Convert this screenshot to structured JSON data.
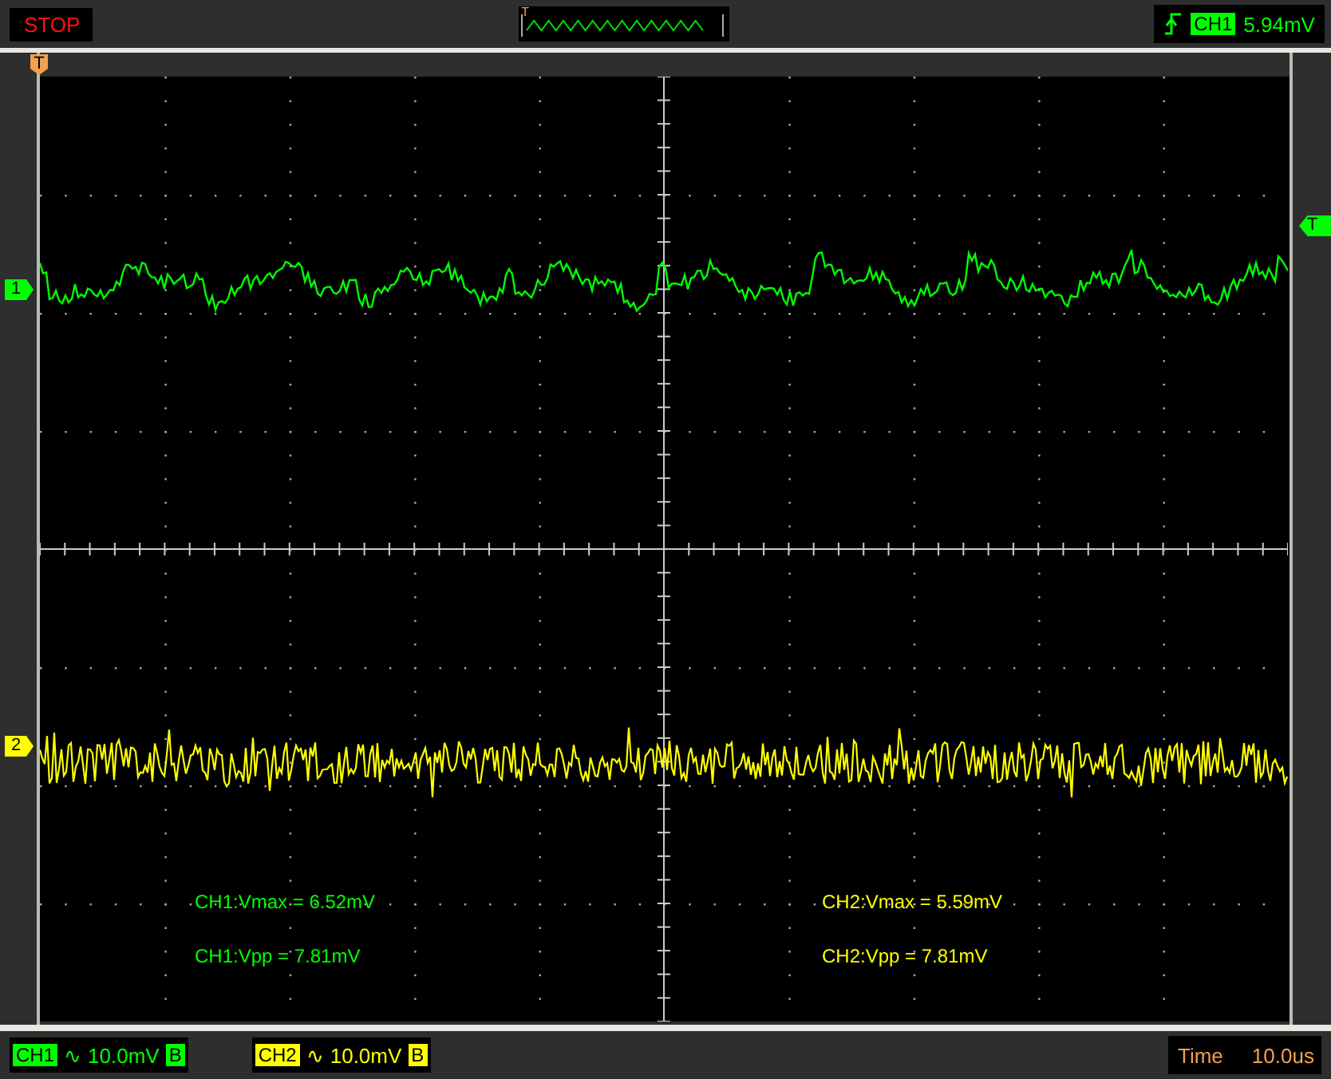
{
  "status": "STOP",
  "overview": {
    "marker": "T"
  },
  "trigger": {
    "channel": "CH1",
    "level": "5.94mV"
  },
  "markers": {
    "top": "T",
    "right": "T"
  },
  "channels": [
    {
      "marker": "1",
      "name": "CH1",
      "coupling": "∿",
      "scale": "10.0mV",
      "bandwidth": "B",
      "color": "#00ff00"
    },
    {
      "marker": "2",
      "name": "CH2",
      "coupling": "∿",
      "scale": "10.0mV",
      "bandwidth": "B",
      "color": "#ffff00"
    }
  ],
  "measurements": [
    {
      "text": "CH1:Vmax = 6.52mV",
      "color": "#00ff00"
    },
    {
      "text": "CH2:Vmax = 5.59mV",
      "color": "#ffff00"
    },
    {
      "text": "CH1:Vpp = 7.81mV",
      "color": "#00ff00"
    },
    {
      "text": "CH2:Vpp = 7.81mV",
      "color": "#ffff00"
    }
  ],
  "timebase": {
    "label": "Time",
    "value": "10.0us"
  }
}
